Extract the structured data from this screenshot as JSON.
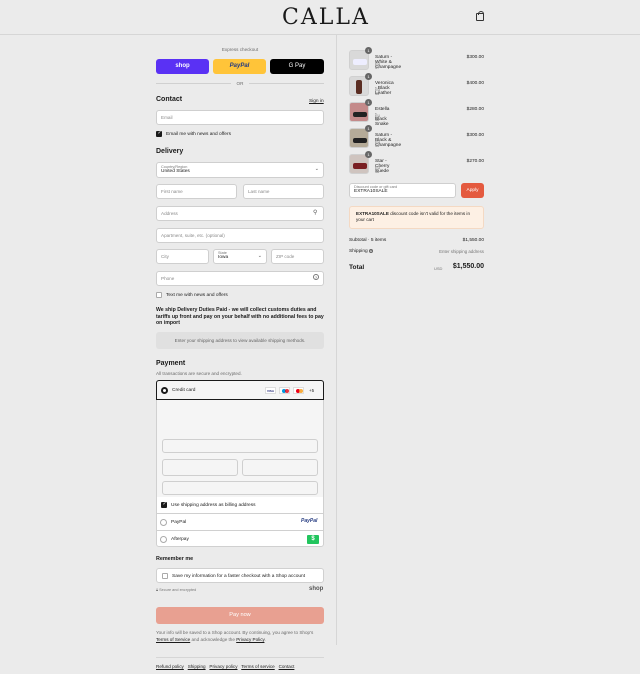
{
  "header": {
    "logo": "CALLA",
    "cart_icon": "shopping-bag-icon"
  },
  "express": {
    "label": "Express checkout",
    "shop": "shop",
    "paypal": "PayPal",
    "gpay": "G Pay",
    "or": "OR"
  },
  "contact": {
    "title": "Contact",
    "signin": "Sign in",
    "email_placeholder": "Email",
    "newsletter": "Email me with news and offers"
  },
  "delivery": {
    "title": "Delivery",
    "country_label": "Country/Region",
    "country_value": "United States",
    "first_name": "First name",
    "last_name": "Last name",
    "address": "Address",
    "apartment": "Apartment, suite, etc. (optional)",
    "city": "City",
    "state_label": "State",
    "state_value": "Iowa",
    "zip": "ZIP code",
    "phone": "Phone",
    "text_me": "Text me with news and offers",
    "duties_notice": "We ship Delivery Duties Paid - we will collect customs duties and tariffs up front and pay on your behalf with no additional fees to pay on import",
    "shipping_info": "Enter your shipping address to view available shipping methods."
  },
  "payment": {
    "title": "Payment",
    "subtitle": "All transactions are secure and encrypted.",
    "credit_card": "Credit card",
    "more_cards": "+5",
    "billing_same": "Use shipping address as billing address",
    "paypal": "PayPal",
    "paypal_logo": "PayPal",
    "afterpay": "Afterpay",
    "afterpay_logo": "$"
  },
  "remember": {
    "title": "Remember me",
    "save_info": "Save my information for a faster checkout with a Shop account",
    "secure": "Secure and encrypted",
    "shop": "shop"
  },
  "pay_button": "Pay now",
  "legal": {
    "text": "Your info will be saved to a Shop account. By continuing, you agree to Shop's",
    "tos": "Terms of Service",
    "and": "and acknowledge the",
    "privacy": "Privacy Policy",
    "period": "."
  },
  "footer_links": [
    "Refund policy",
    "Shipping",
    "Privacy policy",
    "Terms of service",
    "Contact"
  ],
  "cart": {
    "items": [
      {
        "qty": "1",
        "name": "Saturn - White & Champagne",
        "size": "EU 37",
        "price": "$300.00",
        "color": "#8fa7b3"
      },
      {
        "qty": "1",
        "name": "Veronica - Black Leather",
        "size": "EU 36",
        "price": "$400.00",
        "color": "#9a6b5c"
      },
      {
        "qty": "1",
        "name": "Estella - Black Snake",
        "size": "EU 38",
        "price": "$280.00",
        "color": "#b07c7c"
      },
      {
        "qty": "1",
        "name": "Saturn - Black & Champagne",
        "size": "EU 36",
        "price": "$300.00",
        "color": "#8d8474"
      },
      {
        "qty": "1",
        "name": "Star - Cherry Suede",
        "size": "EU 38",
        "price": "$270.00",
        "color": "#a66a6a"
      }
    ],
    "discount_label": "Discount code or gift card",
    "discount_value": "EXTRA10SALE",
    "apply": "Apply",
    "error_code": "EXTRA10SALE",
    "error_text": "discount code isn't valid for the items in your cart",
    "subtotal_label": "Subtotal · 5 items",
    "subtotal": "$1,550.00",
    "shipping_label": "Shipping",
    "shipping_value": "Enter shipping address",
    "total_label": "Total",
    "currency": "USD",
    "total": "$1,550.00"
  }
}
